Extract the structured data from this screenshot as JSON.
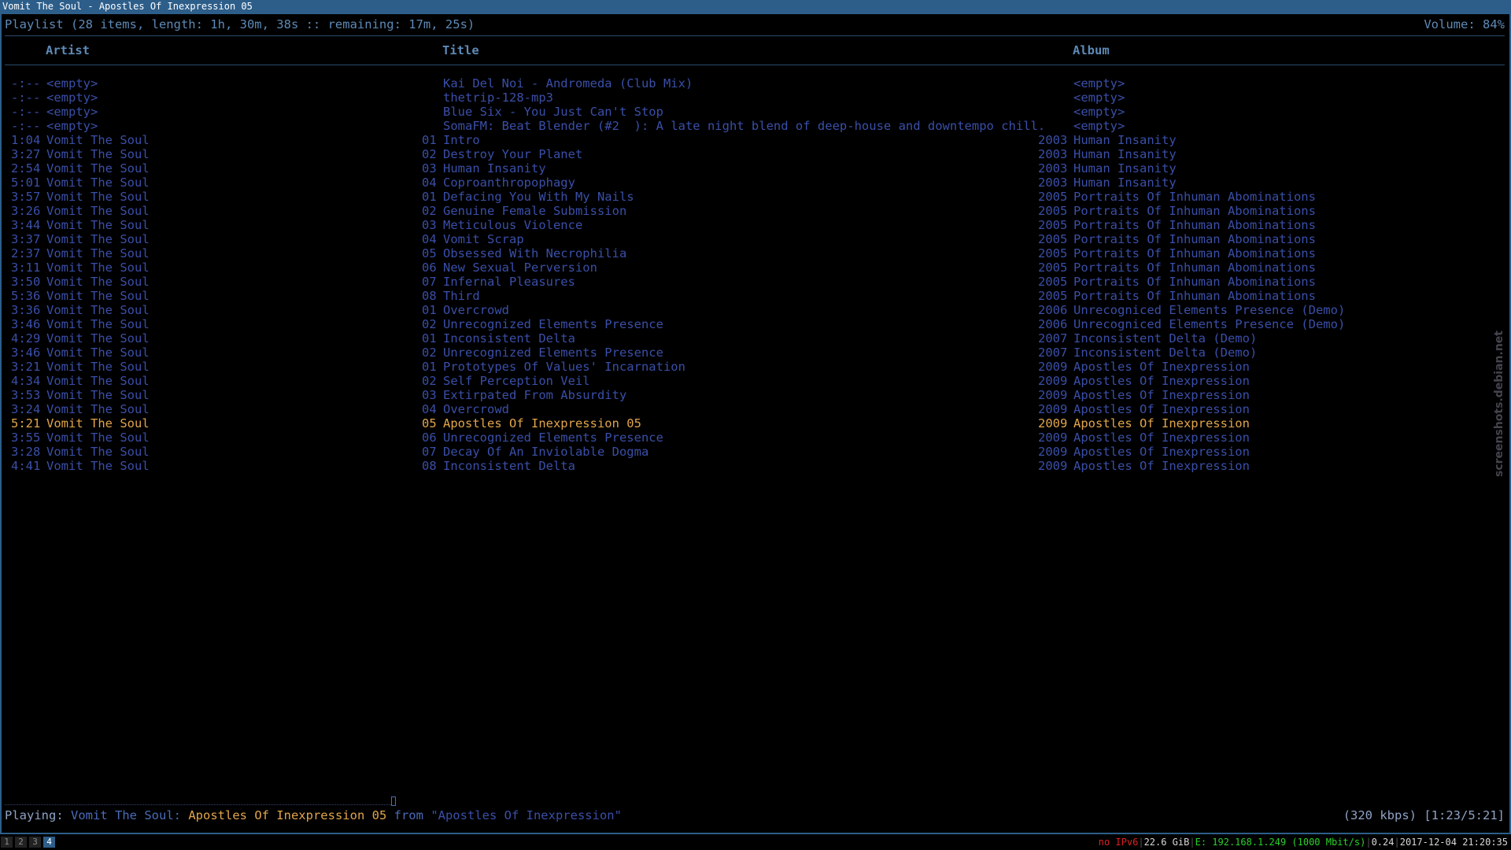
{
  "window": {
    "title": "Vomit The Soul - Apostles Of Inexpression 05"
  },
  "header": {
    "info": "Playlist (28 items, length: 1h, 30m, 38s :: remaining: 17m, 25s)",
    "volume": "Volume: 84%"
  },
  "columns": {
    "artist": "Artist",
    "title": "Title",
    "album": "Album"
  },
  "rows": [
    {
      "len": "-:--",
      "artist": "<empty>",
      "track": "",
      "title": "Kai Del Noi - Andromeda (Club Mix)",
      "year": "",
      "album": "<empty>",
      "current": false
    },
    {
      "len": "-:--",
      "artist": "<empty>",
      "track": "",
      "title": "thetrip-128-mp3",
      "year": "",
      "album": "<empty>",
      "current": false
    },
    {
      "len": "-:--",
      "artist": "<empty>",
      "track": "",
      "title": "Blue Six - You Just Can't Stop",
      "year": "",
      "album": "<empty>",
      "current": false
    },
    {
      "len": "-:--",
      "artist": "<empty>",
      "track": "",
      "title": "SomaFM: Beat Blender (#2  ): A late night blend of deep-house and downtempo chill.",
      "year": "",
      "album": "<empty>",
      "current": false
    },
    {
      "len": "1:04",
      "artist": "Vomit The Soul",
      "track": "01",
      "title": "Intro",
      "year": "2003",
      "album": "Human Insanity",
      "current": false
    },
    {
      "len": "3:27",
      "artist": "Vomit The Soul",
      "track": "02",
      "title": "Destroy Your Planet",
      "year": "2003",
      "album": "Human Insanity",
      "current": false
    },
    {
      "len": "2:54",
      "artist": "Vomit The Soul",
      "track": "03",
      "title": "Human Insanity",
      "year": "2003",
      "album": "Human Insanity",
      "current": false
    },
    {
      "len": "5:01",
      "artist": "Vomit The Soul",
      "track": "04",
      "title": "Coproanthropophagy",
      "year": "2003",
      "album": "Human Insanity",
      "current": false
    },
    {
      "len": "3:57",
      "artist": "Vomit The Soul",
      "track": "01",
      "title": "Defacing You With My Nails",
      "year": "2005",
      "album": "Portraits Of Inhuman Abominations",
      "current": false
    },
    {
      "len": "3:26",
      "artist": "Vomit The Soul",
      "track": "02",
      "title": "Genuine Female Submission",
      "year": "2005",
      "album": "Portraits Of Inhuman Abominations",
      "current": false
    },
    {
      "len": "3:44",
      "artist": "Vomit The Soul",
      "track": "03",
      "title": "Meticulous Violence",
      "year": "2005",
      "album": "Portraits Of Inhuman Abominations",
      "current": false
    },
    {
      "len": "3:37",
      "artist": "Vomit The Soul",
      "track": "04",
      "title": "Vomit Scrap",
      "year": "2005",
      "album": "Portraits Of Inhuman Abominations",
      "current": false
    },
    {
      "len": "2:37",
      "artist": "Vomit The Soul",
      "track": "05",
      "title": "Obsessed With Necrophilia",
      "year": "2005",
      "album": "Portraits Of Inhuman Abominations",
      "current": false
    },
    {
      "len": "3:11",
      "artist": "Vomit The Soul",
      "track": "06",
      "title": "New Sexual Perversion",
      "year": "2005",
      "album": "Portraits Of Inhuman Abominations",
      "current": false
    },
    {
      "len": "3:50",
      "artist": "Vomit The Soul",
      "track": "07",
      "title": "Infernal Pleasures",
      "year": "2005",
      "album": "Portraits Of Inhuman Abominations",
      "current": false
    },
    {
      "len": "5:36",
      "artist": "Vomit The Soul",
      "track": "08",
      "title": "Third",
      "year": "2005",
      "album": "Portraits Of Inhuman Abominations",
      "current": false
    },
    {
      "len": "3:36",
      "artist": "Vomit The Soul",
      "track": "01",
      "title": "Overcrowd",
      "year": "2006",
      "album": "Unrecogniced Elements Presence (Demo)",
      "current": false
    },
    {
      "len": "3:46",
      "artist": "Vomit The Soul",
      "track": "02",
      "title": "Unrecognized Elements Presence",
      "year": "2006",
      "album": "Unrecogniced Elements Presence (Demo)",
      "current": false
    },
    {
      "len": "4:29",
      "artist": "Vomit The Soul",
      "track": "01",
      "title": "Inconsistent Delta",
      "year": "2007",
      "album": "Inconsistent Delta (Demo)",
      "current": false
    },
    {
      "len": "3:46",
      "artist": "Vomit The Soul",
      "track": "02",
      "title": "Unrecognized Elements Presence",
      "year": "2007",
      "album": "Inconsistent Delta (Demo)",
      "current": false
    },
    {
      "len": "3:21",
      "artist": "Vomit The Soul",
      "track": "01",
      "title": "Prototypes Of Values' Incarnation",
      "year": "2009",
      "album": "Apostles Of Inexpression",
      "current": false
    },
    {
      "len": "4:34",
      "artist": "Vomit The Soul",
      "track": "02",
      "title": "Self Perception Veil",
      "year": "2009",
      "album": "Apostles Of Inexpression",
      "current": false
    },
    {
      "len": "3:53",
      "artist": "Vomit The Soul",
      "track": "03",
      "title": "Extirpated From Absurdity",
      "year": "2009",
      "album": "Apostles Of Inexpression",
      "current": false
    },
    {
      "len": "3:24",
      "artist": "Vomit The Soul",
      "track": "04",
      "title": "Overcrowd",
      "year": "2009",
      "album": "Apostles Of Inexpression",
      "current": false
    },
    {
      "len": "5:21",
      "artist": "Vomit The Soul",
      "track": "05",
      "title": "Apostles Of Inexpression 05",
      "year": "2009",
      "album": "Apostles Of Inexpression",
      "current": true
    },
    {
      "len": "3:55",
      "artist": "Vomit The Soul",
      "track": "06",
      "title": "Unrecognized Elements Presence",
      "year": "2009",
      "album": "Apostles Of Inexpression",
      "current": false
    },
    {
      "len": "3:28",
      "artist": "Vomit The Soul",
      "track": "07",
      "title": "Decay Of An Inviolable Dogma",
      "year": "2009",
      "album": "Apostles Of Inexpression",
      "current": false
    },
    {
      "len": "4:41",
      "artist": "Vomit The Soul",
      "track": "08",
      "title": "Inconsistent Delta",
      "year": "2009",
      "album": "Apostles Of Inexpression",
      "current": false
    }
  ],
  "status": {
    "label": "Playing:",
    "artist": "Vomit The Soul:",
    "title": "Apostles Of Inexpression 05",
    "from": "from",
    "album": "\"Apostles Of Inexpression\"",
    "right": "(320 kbps) [1:23/5:21]",
    "progress": 0.258
  },
  "watermark": "screenshots.debian.net",
  "taskbar": {
    "workspaces": [
      "1",
      "2",
      "3",
      "4"
    ],
    "active_workspace": "4",
    "ipv6": "no IPv6",
    "disk": "22.6 GiB",
    "eth": "E: 192.168.1.249 (1000 Mbit/s)",
    "load": "0.24",
    "time": "2017-12-04 21:20:35"
  },
  "colors": {
    "normal_text": "#3a4fa8",
    "current_text": "#e2a54a",
    "titlebar_bg": "#2d5e8a"
  }
}
